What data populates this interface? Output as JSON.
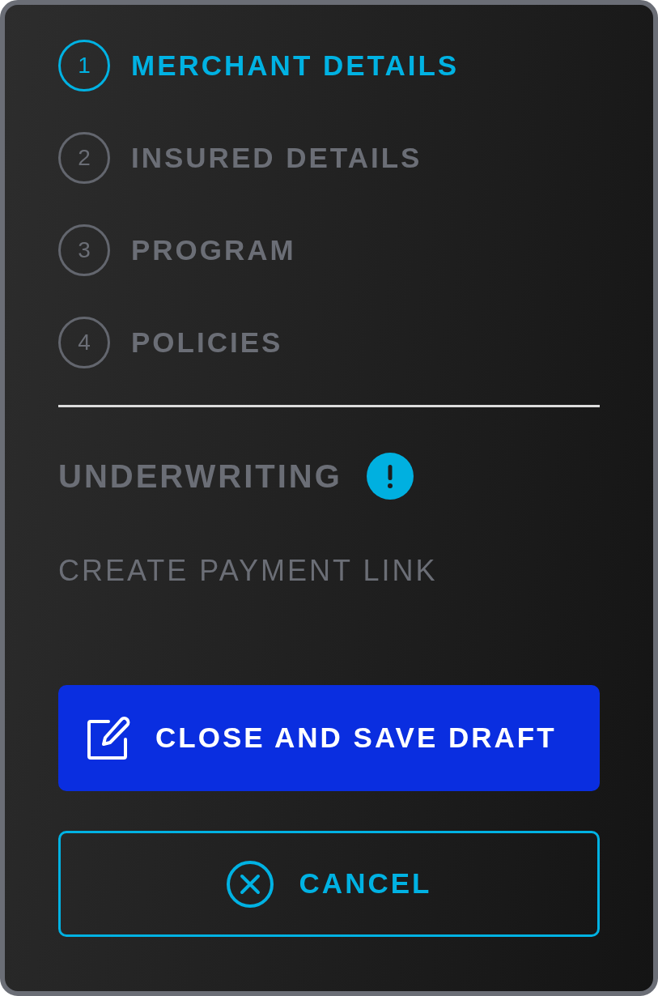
{
  "steps": [
    {
      "number": "1",
      "label": "MERCHANT DETAILS",
      "selected": true
    },
    {
      "number": "2",
      "label": "INSURED DETAILS",
      "selected": false
    },
    {
      "number": "3",
      "label": "PROGRAM",
      "selected": false
    },
    {
      "number": "4",
      "label": "POLICIES",
      "selected": false
    }
  ],
  "underwriting": {
    "label": "UNDERWRITING",
    "warning": true
  },
  "payment_link": {
    "label": "CREATE PAYMENT LINK"
  },
  "buttons": [
    {
      "label": "CLOSE AND SAVE DRAFT",
      "kind": "primary"
    },
    {
      "label": "CANCEL",
      "kind": "secondary"
    }
  ]
}
